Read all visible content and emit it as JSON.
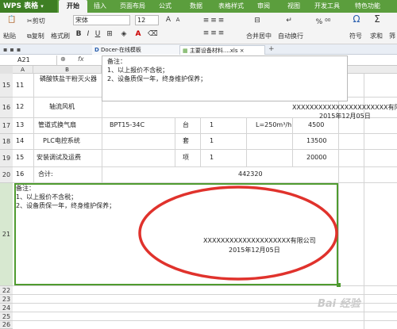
{
  "app": {
    "title": "WPS 表格"
  },
  "ribbon_tabs": [
    "开始",
    "插入",
    "页面布局",
    "公式",
    "数据",
    "表格样式",
    "审阅",
    "视图",
    "开发工具",
    "特色功能"
  ],
  "ribbon": {
    "cut": "剪切",
    "paste": "粘贴",
    "copy": "复制",
    "format_painter": "格式刷",
    "font_name": "宋体",
    "font_size": "12",
    "merge_center": "合并居中",
    "wrap_text": "自动换行",
    "symbol": "符号",
    "sum": "求和",
    "filter": "筛"
  },
  "doc_tabs": [
    "Docer-在线模板",
    "主要设备材料....xls"
  ],
  "formula_bar": {
    "name_box": "A21",
    "fx": "fx",
    "content_line1": "备注：",
    "content_line2": "1、以上报价不含税；",
    "content_line3": "2、设备质保一年，终身维护保养；"
  },
  "columns": [
    "A",
    "B"
  ],
  "rows": [
    {
      "row_num": "15",
      "seq": "11",
      "name": "磷酸铁盐干粉灭火器"
    },
    {
      "row_num": "16",
      "seq": "12",
      "name": "轴流风机"
    },
    {
      "row_num": "17",
      "seq": "13",
      "name": "管道式换气扇",
      "model": "BPT15-34C",
      "unit": "台",
      "qty": "1",
      "spec": "L=250m³/h",
      "price": "4500"
    },
    {
      "row_num": "18",
      "seq": "14",
      "name": "PLC电控系统",
      "unit": "套",
      "qty": "1",
      "price": "13500"
    },
    {
      "row_num": "19",
      "seq": "15",
      "name": "安装调试及运费",
      "unit": "项",
      "qty": "1",
      "price": "20000"
    },
    {
      "row_num": "20",
      "seq": "16",
      "name": "合计:",
      "total": "442320"
    }
  ],
  "floating_note": {
    "company": "XXXXXXXXXXXXXXXXXXXXXX有限公司",
    "date": "2015年12月05日"
  },
  "remark_cell": {
    "row_num": "21",
    "line1": "备注：",
    "line2": "1、以上报价不含税；",
    "line3": "2、设备质保一年，终身维护保养；",
    "company": "XXXXXXXXXXXXXXXXXXXX有限公司",
    "date": "2015年12月05日"
  },
  "empty_rows": [
    "22",
    "23",
    "24",
    "25",
    "26"
  ],
  "watermark": "Bai 经验",
  "colors": {
    "accent_green": "#5b9e3d",
    "circle_red": "#e0322c"
  }
}
